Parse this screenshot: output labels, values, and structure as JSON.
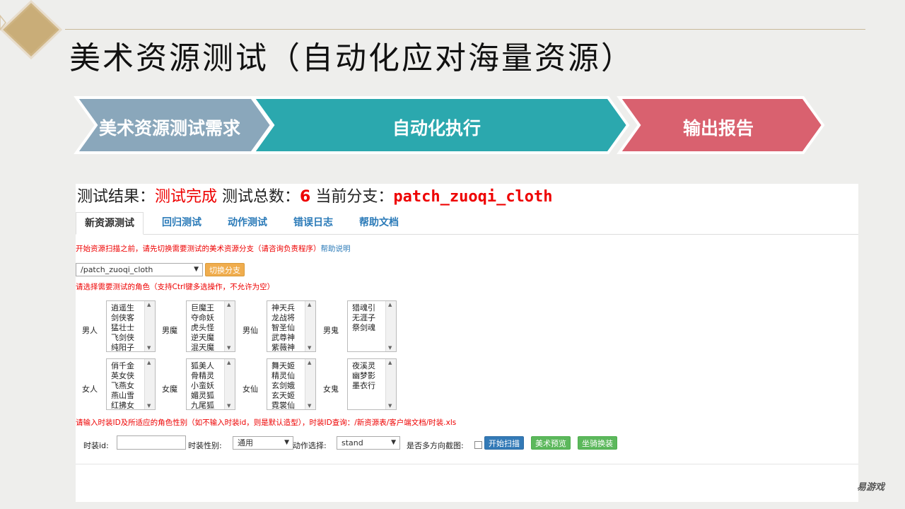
{
  "slide": {
    "title": "美术资源测试（自动化应对海量资源）",
    "logo": "易游戏"
  },
  "flow": {
    "steps": [
      {
        "label": "美术资源测试需求",
        "color": "#8aa7bb"
      },
      {
        "label": "自动化执行",
        "color": "#2ba8ae"
      },
      {
        "label": "输出报告",
        "color": "#d9616f"
      }
    ]
  },
  "result": {
    "label_result": "测试结果：",
    "status": "测试完成",
    "label_total": "测试总数：",
    "total": "6",
    "label_branch": "当前分支：",
    "branch": "patch_zuoqi_cloth"
  },
  "tabs": [
    {
      "label": "新资源测试",
      "active": true
    },
    {
      "label": "回归测试"
    },
    {
      "label": "动作测试"
    },
    {
      "label": "错误日志"
    },
    {
      "label": "帮助文档"
    }
  ],
  "notices": {
    "branch_hint": "开始资源扫描之前，请先切换需要测试的美术资源分支（请咨询负责程序）",
    "help_link": "帮助说明",
    "role_hint": "请选择需要测试的角色（支持Ctrl键多选操作，不允许为空）",
    "costume_hint": "请输入时装ID及所适应的角色性别（如不输入时装id，则是默认造型），时装ID查询：/新资源表/客户端文档/时装.xls"
  },
  "branch_select": {
    "value": "/patch_zuoqi_cloth",
    "button": "切换分支"
  },
  "roles": [
    {
      "label": "男人",
      "items": [
        "逍遥生",
        "剑侠客",
        "猛壮士",
        "飞剑侠",
        "纯阳子"
      ]
    },
    {
      "label": "男魔",
      "items": [
        "巨魔王",
        "夺命妖",
        "虎头怪",
        "逆天魔",
        "混天魔"
      ]
    },
    {
      "label": "男仙",
      "items": [
        "神天兵",
        "龙战将",
        "智圣仙",
        "武尊神",
        "紫薇神"
      ]
    },
    {
      "label": "男鬼",
      "items": [
        "猎魂引",
        "无涯子",
        "祭剑魂"
      ]
    },
    {
      "label": "女人",
      "items": [
        "俏千金",
        "英女侠",
        "飞燕女",
        "燕山雪",
        "红拂女"
      ]
    },
    {
      "label": "女魔",
      "items": [
        "狐美人",
        "骨精灵",
        "小蛮妖",
        "媚灵狐",
        "九尾狐"
      ]
    },
    {
      "label": "女仙",
      "items": [
        "舞天姬",
        "精灵仙",
        "玄剑娥",
        "玄天姬",
        "霓裳仙"
      ]
    },
    {
      "label": "女鬼",
      "items": [
        "夜溪灵",
        "幽梦影",
        "墨衣行"
      ]
    }
  ],
  "form": {
    "costume_id_label": "时装id:",
    "costume_id_value": "",
    "gender_label": "时装性别:",
    "gender_value": "通用",
    "action_label": "动作选择:",
    "action_value": "stand",
    "multi_dir_label": "是否多方向截图:",
    "multi_dir_checked": false,
    "scan_button": "开始扫描",
    "preview_button": "美术预览",
    "mount_button": "坐骑换装"
  }
}
